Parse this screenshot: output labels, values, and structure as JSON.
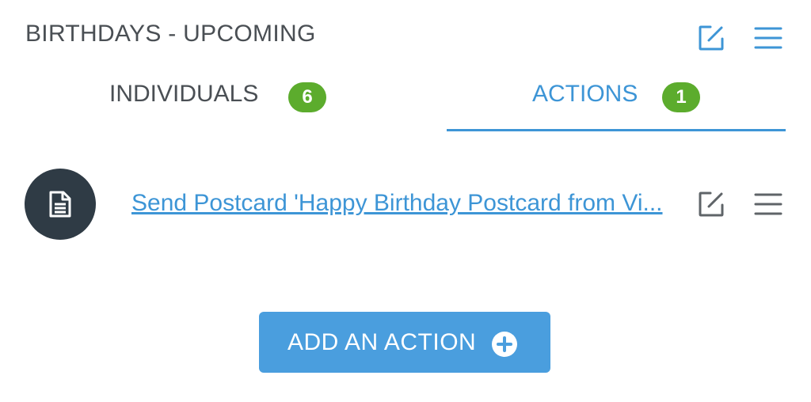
{
  "header": {
    "title": "BIRTHDAYS - UPCOMING",
    "edit_icon": "edit-icon",
    "menu_icon": "menu-icon"
  },
  "tabs": [
    {
      "label": "INDIVIDUALS",
      "count": "6",
      "active": false
    },
    {
      "label": "ACTIONS",
      "count": "1",
      "active": true
    }
  ],
  "actions": [
    {
      "icon": "document-icon",
      "label": "Send Postcard 'Happy Birthday Postcard from Vi..."
    }
  ],
  "add_button": {
    "label": "ADD AN ACTION",
    "icon": "plus-circle-icon"
  },
  "colors": {
    "accent": "#3d95d6",
    "badge": "#5cac2d",
    "text": "#4a4f54",
    "avatar": "#2f3b45",
    "button": "#4a9ede"
  }
}
